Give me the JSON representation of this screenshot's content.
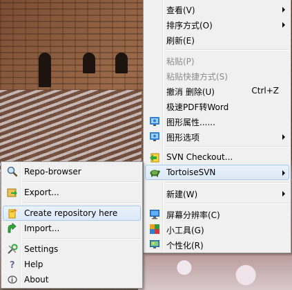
{
  "context_menu": {
    "items": [
      {
        "label": "查看(V)",
        "submenu": true
      },
      {
        "label": "排序方式(O)",
        "submenu": true
      },
      {
        "label": "刷新(E)"
      },
      {
        "label": "粘贴(P)",
        "disabled": true
      },
      {
        "label": "粘贴快捷方式(S)",
        "disabled": true
      },
      {
        "label": "撤消 删除(U)",
        "shortcut": "Ctrl+Z"
      },
      {
        "label": "极速PDF转Word"
      },
      {
        "label": "图形属性......",
        "icon": "graphics-properties-icon"
      },
      {
        "label": "图形选项",
        "icon": "graphics-options-icon",
        "submenu": true
      },
      {
        "label": "SVN Checkout...",
        "icon": "svn-checkout-icon"
      },
      {
        "label": "TortoiseSVN",
        "icon": "tortoisesvn-icon",
        "submenu": true,
        "highlighted": true
      },
      {
        "label": "新建(W)",
        "submenu": true
      },
      {
        "label": "屏幕分辨率(C)",
        "icon": "screen-resolution-icon"
      },
      {
        "label": "小工具(G)",
        "icon": "gadgets-icon"
      },
      {
        "label": "个性化(R)",
        "icon": "personalize-icon"
      }
    ]
  },
  "tortoisesvn_submenu": {
    "items": [
      {
        "label": "Repo-browser",
        "icon": "repo-browser-icon"
      },
      {
        "label": "Export...",
        "icon": "export-icon"
      },
      {
        "label": "Create repository here",
        "icon": "create-repository-icon",
        "highlighted": true
      },
      {
        "label": "Import...",
        "icon": "import-icon"
      },
      {
        "label": "Settings",
        "icon": "settings-icon"
      },
      {
        "label": "Help",
        "icon": "help-icon"
      },
      {
        "label": "About",
        "icon": "about-icon"
      }
    ]
  },
  "colors": {
    "menu_bg": "#f0f0f0",
    "highlight": "#dbe9f8",
    "highlight_border": "#a8c8ec",
    "disabled_text": "#8d8d8d"
  }
}
